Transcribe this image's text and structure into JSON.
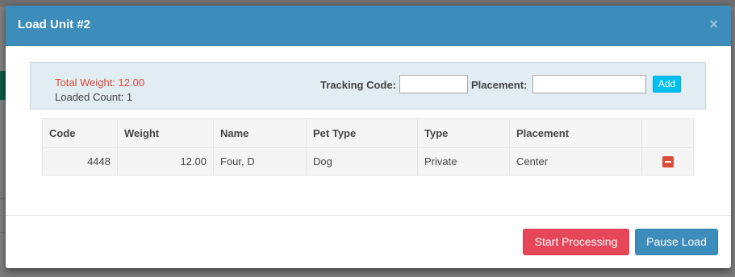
{
  "modal": {
    "title": "Load Unit #2",
    "close_label": "×"
  },
  "summary": {
    "total_weight": "Total Weight: 12.00",
    "loaded_count": "Loaded Count: 1"
  },
  "form": {
    "tracking_label": "Tracking Code:",
    "tracking_value": "",
    "placement_label": "Placement:",
    "placement_value": "",
    "add_label": "Add"
  },
  "table": {
    "headers": [
      "Code",
      "Weight",
      "Name",
      "Pet Type",
      "Type",
      "Placement",
      ""
    ],
    "rows": [
      {
        "code": "4448",
        "weight": "12.00",
        "name": "Four, D",
        "pet_type": "Dog",
        "type": "Private",
        "placement": "Center",
        "action_icon": "remove-icon"
      }
    ]
  },
  "footer": {
    "start_label": "Start Processing",
    "pause_label": "Pause Load"
  },
  "colors": {
    "header": "#3c8dbc",
    "danger": "#dd4b39",
    "start_button": "#e64758",
    "add_button": "#00c0ef",
    "panel": "#e1ecf3"
  }
}
